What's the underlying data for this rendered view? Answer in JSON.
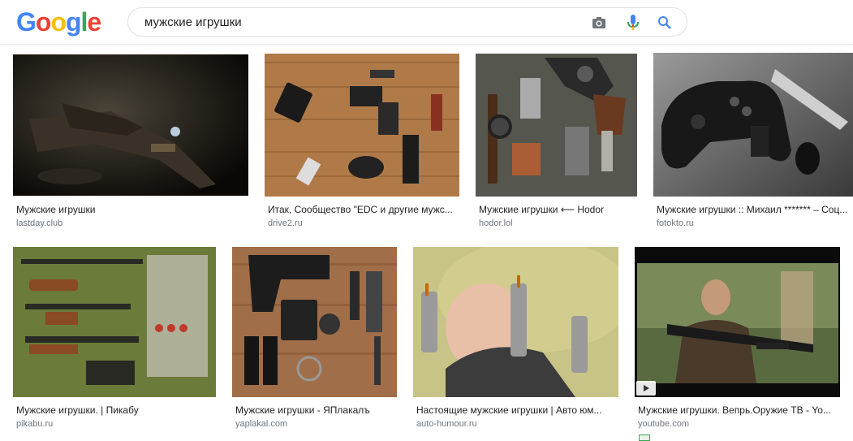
{
  "header": {
    "logo_letters": [
      "G",
      "o",
      "o",
      "g",
      "l",
      "e"
    ],
    "logo_colors": [
      "#4285F4",
      "#EA4335",
      "#FBBC05",
      "#4285F4",
      "#34A853",
      "#EA4335"
    ],
    "search_value": "мужские игрушки",
    "icons": [
      "camera-icon",
      "microphone-icon",
      "search-icon"
    ]
  },
  "results": [
    {
      "caption": "Мужские игрушки",
      "source": "lastday.club"
    },
    {
      "caption": "Итак, Сообщество \"EDC и другие мужс...",
      "source": "drive2.ru"
    },
    {
      "caption": "Мужские игрушки ⟵ Hodor",
      "source": "hodor.lol"
    },
    {
      "caption": "Мужские игрушки :: Михаил ******* – Соц...",
      "source": "fotokto.ru"
    },
    {
      "caption": "Мужские игрушки. | Пикабу",
      "source": "pikabu.ru"
    },
    {
      "caption": "Мужские игрушки - ЯПлакалъ",
      "source": "yaplakal.com"
    },
    {
      "caption": "Настоящие мужские игрушки | Авто юм...",
      "source": "auto-humour.ru"
    },
    {
      "caption": "Мужские игрушки. Вепрь.Оружие ТВ - Yo...",
      "source": "youtube.com"
    }
  ]
}
